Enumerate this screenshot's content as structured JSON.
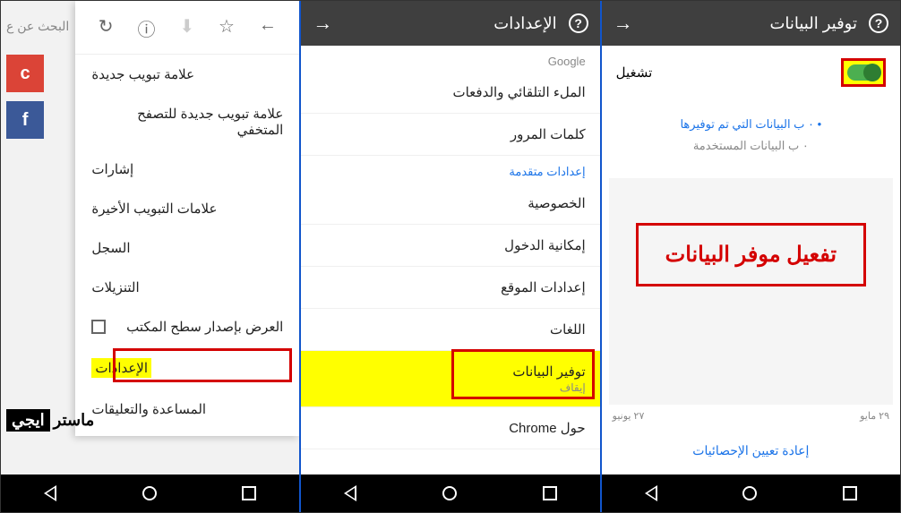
{
  "pane1": {
    "search_placeholder": "البحث عن ع",
    "shortcuts": [
      "c",
      "f"
    ],
    "toolbar_icons": [
      "history-icon",
      "info-icon",
      "download-icon",
      "star-icon",
      "forward-icon"
    ],
    "menu": [
      "علامة تبويب جديدة",
      "علامة تبويب جديدة للتصفح المتخفي",
      "إشارات",
      "علامات التبويب الأخيرة",
      "السجل",
      "التنزيلات",
      "العرض بإصدار سطح المكتب",
      "الإعدادات",
      "المساعدة والتعليقات"
    ],
    "watermark_black": "ايجي",
    "watermark_white": "ماستر"
  },
  "pane2": {
    "title": "الإعدادات",
    "section_basic": "Google",
    "items_basic": [
      "الملء التلقائي والدفعات",
      "كلمات المرور"
    ],
    "section_advanced": "إعدادات متقدمة",
    "items_advanced": [
      "الخصوصية",
      "إمكانية الدخول",
      "إعدادات الموقع",
      "اللغات"
    ],
    "data_saver": {
      "label": "توفير البيانات",
      "status": "إيقاف"
    },
    "about": "حول Chrome"
  },
  "pane3": {
    "title": "توفير البيانات",
    "toggle_label": "تشغيل",
    "saved_text": "٠ ب البيانات التي تم توفيرها",
    "used_text": "٠ ب البيانات المستخدمة",
    "date_start": "٢٧ يونيو",
    "date_end": "٢٩ مايو",
    "reset": "إعادة تعيين الإحصائيات",
    "big_label": "تفعيل موفر البيانات"
  }
}
